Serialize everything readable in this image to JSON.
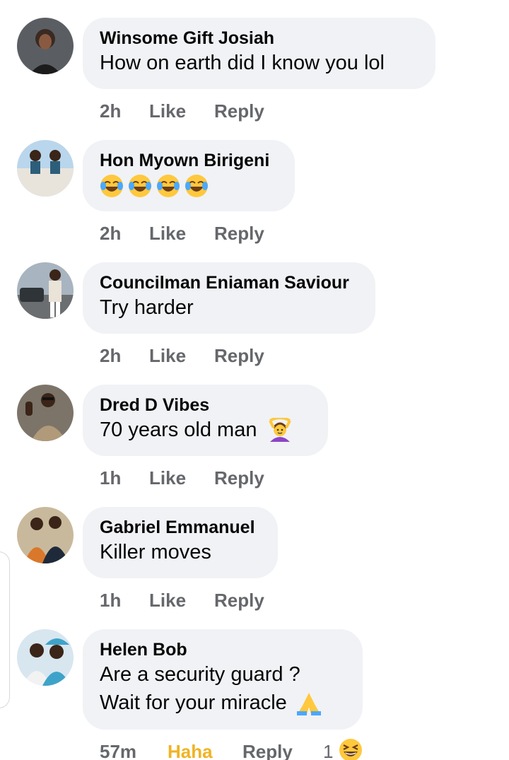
{
  "comments": [
    {
      "author": "Winsome Gift Josiah",
      "text": "How on earth did I know you lol",
      "time": "2h",
      "like_label": "Like",
      "reply_label": "Reply"
    },
    {
      "author": "Hon Myown Birigeni",
      "text": "",
      "emoji": [
        "face-with-tears-of-joy",
        "face-with-tears-of-joy",
        "face-with-tears-of-joy",
        "face-with-tears-of-joy"
      ],
      "time": "2h",
      "like_label": "Like",
      "reply_label": "Reply"
    },
    {
      "author": "Councilman Eniaman Saviour",
      "text": "Try harder",
      "time": "2h",
      "like_label": "Like",
      "reply_label": "Reply"
    },
    {
      "author": "Dred D Vibes",
      "text": "70 years old man",
      "emoji": [
        "person-gesturing-ok"
      ],
      "time": "1h",
      "like_label": "Like",
      "reply_label": "Reply"
    },
    {
      "author": "Gabriel Emmanuel",
      "text": "Killer moves",
      "time": "1h",
      "like_label": "Like",
      "reply_label": "Reply"
    },
    {
      "author": "Helen Bob",
      "text_line1": "Are a security guard ?",
      "text_line2": "Wait for your miracle",
      "emoji": [
        "folded-hands"
      ],
      "time": "57m",
      "reaction_label": "Haha",
      "reply_label": "Reply",
      "reaction_count": "1",
      "reaction_emoji": "grinning-squinting-face"
    }
  ],
  "colors": {
    "bubble": "#f0f2f5",
    "meta_text": "#65676b",
    "haha_active": "#f0b323",
    "author_text": "#050505"
  }
}
